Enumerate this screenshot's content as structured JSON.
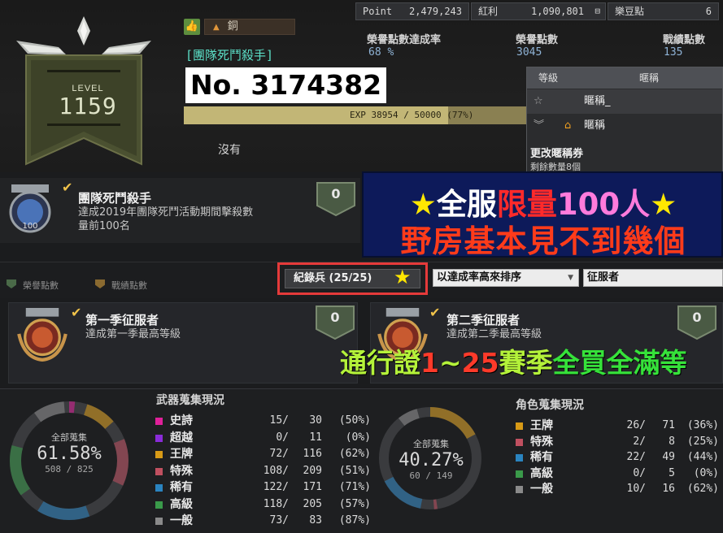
{
  "profile": {
    "level_label": "LEVEL",
    "level_value": "1159",
    "rank_name": "銅",
    "title_name": "[團隊死鬥殺手]",
    "player_no": "No. 3174382",
    "exp_text": "EXP 38954 / 50000 (77%)",
    "exp_progress": 0.77,
    "no_title_text": "沒有"
  },
  "stats": {
    "point_label": "Point",
    "point_value": "2,479,243",
    "bonus_label": "紅利",
    "bonus_value": "1,090,801",
    "bean_label": "樂豆點",
    "bean_value": "6",
    "rate_title": "榮譽點數達成率",
    "rate_value": "68 %",
    "honor_title": "榮譽點數",
    "honor_value": "3045",
    "merit_title": "戰績點數",
    "merit_value": "135"
  },
  "title_popup": {
    "col_level": "等級",
    "col_title": "暱稱",
    "row1_title": "暱稱_",
    "row2_title": "暱稱",
    "change_label": "更改暱稱券",
    "remain_label": "剩餘數量8個"
  },
  "featured": {
    "title": "團隊死鬥殺手",
    "desc1": "達成2019年團隊死鬥活動期間擊殺數",
    "desc2": "量前100名",
    "badge_num": "100",
    "score": "0"
  },
  "promo": {
    "line1_star": "★",
    "line1_a": "全服",
    "line1_b": "限量",
    "line1_c": "100人",
    "line2": "野房基本見不到幾個",
    "line3_a": "通行證",
    "line3_b": "1",
    "line3_c": "~",
    "line3_d": "25",
    "line3_e": "賽季",
    "line3_f": "全買全滿等"
  },
  "filters": {
    "legend_honor": "榮譽點數",
    "legend_merit": "戰績點數",
    "record_label": "紀錄兵 (25/25)",
    "sort_label": "以達成率高來排序",
    "category_label": "征服者"
  },
  "cards": [
    {
      "title": "第一季征服者",
      "desc": "達成第一季最高等級",
      "score": "0"
    },
    {
      "title": "第二季征服者",
      "desc": "達成第二季最高等級",
      "score": "0"
    }
  ],
  "weapons": {
    "title": "武器蒐集現況",
    "total_label": "全部蒐集",
    "percent": "61.58%",
    "count": "508 / 825",
    "rows": [
      {
        "name": "史詩",
        "have": "15/",
        "total": "30",
        "pct": "(50%)",
        "color": "#e0209a"
      },
      {
        "name": "超越",
        "have": "0/",
        "total": "11",
        "pct": "(0%)",
        "color": "#8a2bd8"
      },
      {
        "name": "王牌",
        "have": "72/",
        "total": "116",
        "pct": "(62%)",
        "color": "#d89a16"
      },
      {
        "name": "特殊",
        "have": "108/",
        "total": "209",
        "pct": "(51%)",
        "color": "#c05060"
      },
      {
        "name": "稀有",
        "have": "122/",
        "total": "171",
        "pct": "(71%)",
        "color": "#2a84c0"
      },
      {
        "name": "高級",
        "have": "118/",
        "total": "205",
        "pct": "(57%)",
        "color": "#3a9a4a"
      },
      {
        "name": "一般",
        "have": "73/",
        "total": "83",
        "pct": "(87%)",
        "color": "#8a8a8a"
      }
    ]
  },
  "characters": {
    "title": "角色蒐集現況",
    "total_label": "全部蒐集",
    "percent": "40.27%",
    "count": "60 / 149",
    "rows": [
      {
        "name": "王牌",
        "have": "26/",
        "total": "71",
        "pct": "(36%)",
        "color": "#d89a16"
      },
      {
        "name": "特殊",
        "have": "2/",
        "total": "8",
        "pct": "(25%)",
        "color": "#c05060"
      },
      {
        "name": "稀有",
        "have": "22/",
        "total": "49",
        "pct": "(44%)",
        "color": "#2a84c0"
      },
      {
        "name": "高級",
        "have": "0/",
        "total": "5",
        "pct": "(0%)",
        "color": "#3a9a4a"
      },
      {
        "name": "一般",
        "have": "10/",
        "total": "16",
        "pct": "(62%)",
        "color": "#8a8a8a"
      }
    ]
  }
}
